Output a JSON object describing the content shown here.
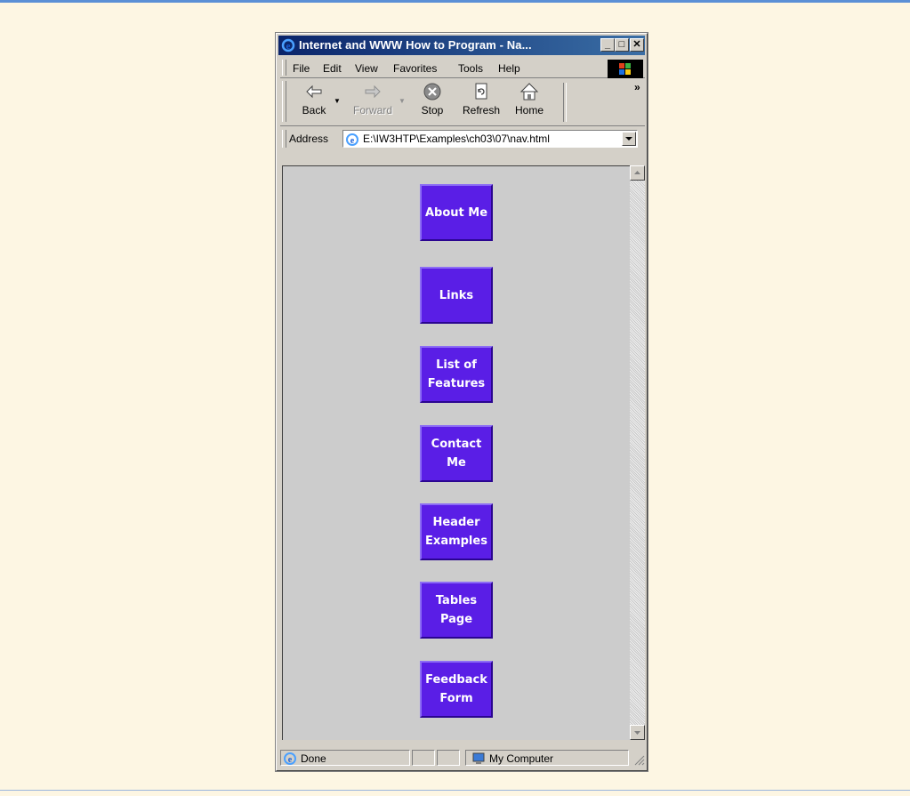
{
  "window": {
    "title": "Internet and WWW How to Program - Na...",
    "controls": {
      "minimize": "_",
      "maximize": "□",
      "close": "✕"
    }
  },
  "menubar": {
    "items": [
      {
        "label": "File",
        "underline": "F"
      },
      {
        "label": "Edit",
        "underline": "E"
      },
      {
        "label": "View",
        "underline": "V"
      },
      {
        "label": "Favorites",
        "underline": "a"
      },
      {
        "label": "Tools",
        "underline": "T"
      },
      {
        "label": "Help",
        "underline": "H"
      }
    ]
  },
  "toolbar": {
    "back_label": "Back",
    "forward_label": "Forward",
    "stop_label": "Stop",
    "refresh_label": "Refresh",
    "home_label": "Home",
    "chevron": "»"
  },
  "address": {
    "label": "Address",
    "url": "E:\\IW3HTP\\Examples\\ch03\\07\\nav.html"
  },
  "nav_buttons": [
    {
      "label": "About Me"
    },
    {
      "label": "Links"
    },
    {
      "label": "List of Features"
    },
    {
      "label": "Contact Me"
    },
    {
      "label": "Header Examples"
    },
    {
      "label": "Tables Page"
    },
    {
      "label": "Feedback Form"
    }
  ],
  "status": {
    "text": "Done",
    "zone": "My Computer"
  },
  "colors": {
    "title_start": "#0a246a",
    "title_end": "#3a6ea5",
    "nav_button": "#5a1ee6",
    "page_bg": "#cccccc",
    "outer_bg": "#fdf6e3"
  }
}
